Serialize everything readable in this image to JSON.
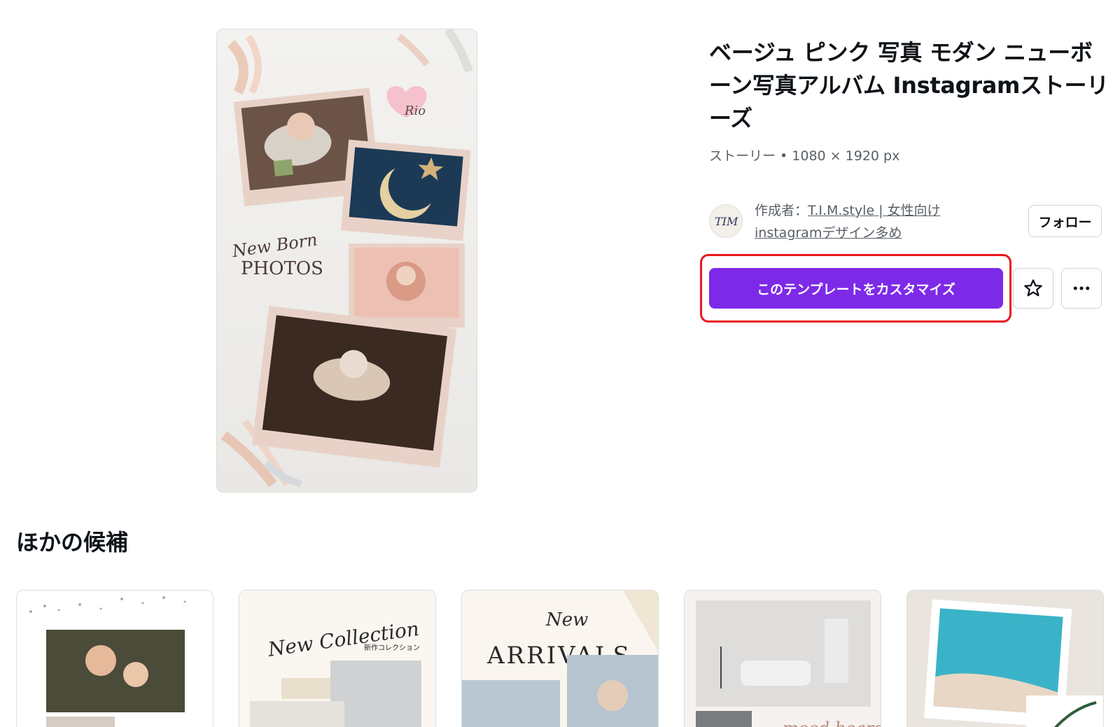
{
  "template": {
    "title": "ベージュ ピンク 写真 モダン ニューボーン写真アルバム Instagramストーリーズ",
    "meta": "ストーリー • 1080 × 1920 px",
    "preview_script_text": "New Born",
    "preview_heading": "PHOTOS",
    "preview_heart_text": "Rio"
  },
  "creator": {
    "prefix": "作成者：",
    "name": "T.I.M.style | 女性向けinstagramデザイン多め",
    "avatar_monogram": "TIM"
  },
  "actions": {
    "follow_label": "フォロー",
    "customize_label": "このテンプレートをカスタマイズ",
    "favorite_icon": "star-icon",
    "more_icon": "more-horizontal-icon"
  },
  "colors": {
    "primary": "#7d2ae8",
    "highlight": "#e8181e"
  },
  "others": {
    "heading": "ほかの候補",
    "cards": [
      {
        "title": ""
      },
      {
        "title": "New Collection",
        "subtitle": "新作コレクション"
      },
      {
        "title": "ARRIVALS",
        "subtitle": "New"
      },
      {
        "title": "mood board"
      },
      {
        "title": ""
      }
    ]
  }
}
